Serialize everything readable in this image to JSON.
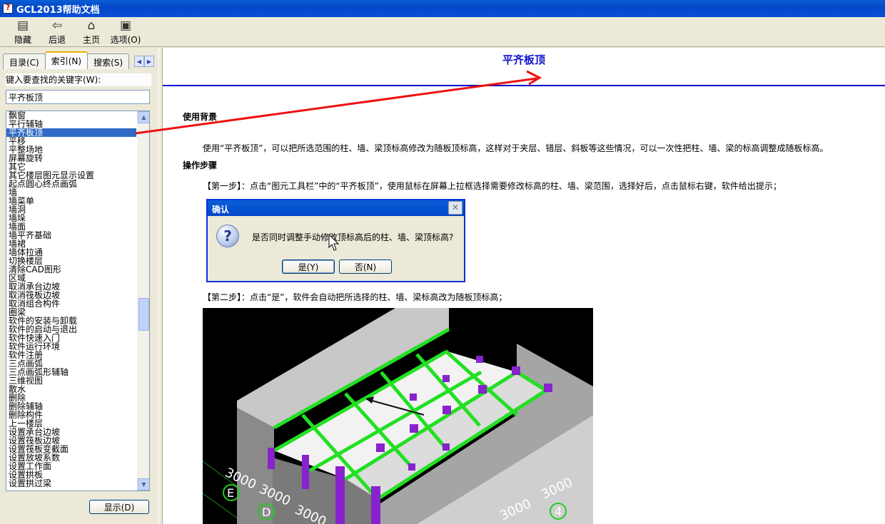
{
  "window": {
    "title": "GCL2013帮助文档"
  },
  "toolbar": {
    "buttons": [
      {
        "label": "隐藏",
        "icon": "hide-icon"
      },
      {
        "label": "后退",
        "icon": "back-arrow-icon"
      },
      {
        "label": "主页",
        "icon": "home-icon"
      },
      {
        "label": "选项(O)",
        "icon": "options-icon"
      }
    ]
  },
  "sidebar": {
    "tabs": [
      {
        "label": "目录(C)"
      },
      {
        "label": "索引(N)"
      },
      {
        "label": "搜索(S)"
      }
    ],
    "keyword_label": "键入要查找的关键字(W):",
    "keyword_value": "平齐板顶",
    "index_items": [
      "飘窗",
      "平行辅轴",
      "平齐板顶",
      "平移",
      "平整场地",
      "屏幕旋转",
      "其它",
      "其它楼层图元显示设置",
      "起点圆心终点画弧",
      "墙",
      "墙菜单",
      "墙洞",
      "墙垛",
      "墙面",
      "墙平齐基础",
      "墙裙",
      "墙体拉通",
      "切换楼层",
      "清除CAD图形",
      "区域",
      "取消承台边坡",
      "取消筏板边坡",
      "取消组合构件",
      "圈梁",
      "软件的安装与卸载",
      "软件的启动与退出",
      "软件快速入门",
      "软件运行环境",
      "软件注册",
      "三点画弧",
      "三点画弧形辅轴",
      "三维视图",
      "散水",
      "删除",
      "删除辅轴",
      "删除构件",
      "上一楼层",
      "设置承台边坡",
      "设置筏板边坡",
      "设置筏板变截面",
      "设置放坡系数",
      "设置工作面",
      "设置拱板",
      "设置拱过梁"
    ],
    "selected_index": 2,
    "show_button": "显示(D)"
  },
  "content": {
    "title": "平齐板顶",
    "section1_heading": "使用背景",
    "section1_text": "使用“平齐板顶”，可以把所选范围的柱、墙、梁顶标高修改为随板顶标高，这样对于夹层、错层、斜板等这些情况，可以一次性把柱、墙、梁的标高调整成随板标高。",
    "section2_heading": "操作步骤",
    "step1": "【第一步】：点击“图元工具栏”中的“平齐板顶”，使用鼠标在屏幕上拉框选择需要修改标高的柱、墙、梁范围，选择好后，点击鼠标右键，软件给出提示；",
    "step2": "【第二步】：点击“是”，软件会自动把所选择的柱、墙、梁标高改为随板顶标高；"
  },
  "dialog": {
    "title": "确认",
    "message": "是否同时调整手动修改顶标高后的柱、墙、梁顶标高?",
    "yes_label": "是(Y)",
    "no_label": "否(N)"
  },
  "scene": {
    "dimension_labels": [
      "3000",
      "3000",
      "3000",
      "3000",
      "3000"
    ],
    "axis_labels": [
      "E",
      "D",
      "4"
    ]
  },
  "colors": {
    "title_blue": "#1111cc",
    "selection": "#316ac5",
    "beam_green": "#22e022",
    "column_purple": "#8822cc",
    "annotation_red": "#ee1111"
  }
}
